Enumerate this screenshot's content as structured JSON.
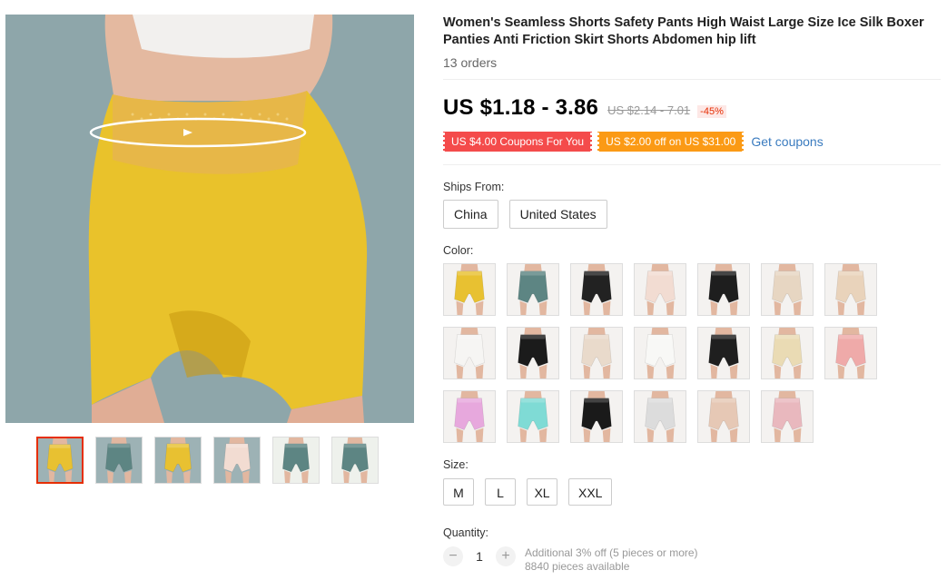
{
  "product": {
    "title": "Women's Seamless Shorts Safety Pants High Waist Large Size Ice Silk Boxer Panties Anti Friction Skirt Shorts Abdomen hip lift",
    "orders": "13 orders"
  },
  "pricing": {
    "price": "US $1.18 - 3.86",
    "original_price": "US $2.14 - 7.01",
    "discount": "-45%"
  },
  "coupons": {
    "items": [
      "US $4.00 Coupons For You",
      "US $2.00 off on US $31.00"
    ],
    "get_label": "Get coupons"
  },
  "ships_from": {
    "label": "Ships From:",
    "options": [
      "China",
      "United States"
    ]
  },
  "color": {
    "label": "Color:",
    "swatches": [
      "#e8c131",
      "#5d8583",
      "#222222",
      "#f2dcd2",
      "#1e1e1e",
      "#e7d6c2",
      "#e9d3bb",
      "#f6f5f3",
      "#1b1b1b",
      "#e9dacb",
      "#f8f8f6",
      "#1f1f1f",
      "#eadbb4",
      "#efaaa9",
      "#e7a8dd",
      "#7fdbd5",
      "#1a1a1a",
      "#dcdcdc",
      "#e6c8b5",
      "#e9b8be"
    ]
  },
  "size": {
    "label": "Size:",
    "options": [
      "M",
      "L",
      "XL",
      "XXL"
    ]
  },
  "quantity": {
    "label": "Quantity:",
    "value": "1",
    "minus": "−",
    "plus": "+",
    "discount_note": "Additional 3% off (5 pieces or more)",
    "available": "8840 pieces available"
  },
  "gallery": {
    "thumbnail_colors": [
      "#e8c131",
      "#5d8583",
      "#e8c131",
      "#f2dcd2",
      "#5d8583",
      "#5d8583"
    ]
  },
  "colors": {
    "accent": "#e62e04",
    "coupon_red": "#f44b4b",
    "coupon_orange": "#fb9a15",
    "link": "#3a7bbf"
  }
}
